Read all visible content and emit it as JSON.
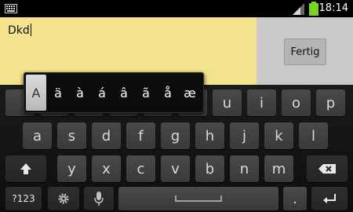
{
  "status_bar": {
    "time": "18:14",
    "icons": [
      "keyboard-icon",
      "signal-icon",
      "battery-icon"
    ],
    "battery_color": "#7ed321"
  },
  "editor": {
    "text": "Dkd"
  },
  "done_button": {
    "label": "Fertig"
  },
  "accent_popup": {
    "keys": [
      "A",
      "ä",
      "à",
      "á",
      "â",
      "ã",
      "å",
      "æ"
    ],
    "selected": "A"
  },
  "keyboard": {
    "row1": [
      "",
      "",
      "",
      "",
      "",
      "",
      "u",
      "i",
      "o",
      "p"
    ],
    "row2": [
      "a",
      "s",
      "d",
      "f",
      "g",
      "h",
      "j",
      "k",
      "l"
    ],
    "row3": [
      "y",
      "x",
      "c",
      "v",
      "b",
      "n",
      "m"
    ],
    "symbols_label": "?123",
    "period": ".",
    "icons": {
      "shift": "shift-arrow-icon",
      "backspace": "backspace-icon",
      "settings": "gear-icon",
      "mic": "microphone-icon",
      "space": "space-bar-icon",
      "enter": "enter-arrow-icon"
    }
  }
}
